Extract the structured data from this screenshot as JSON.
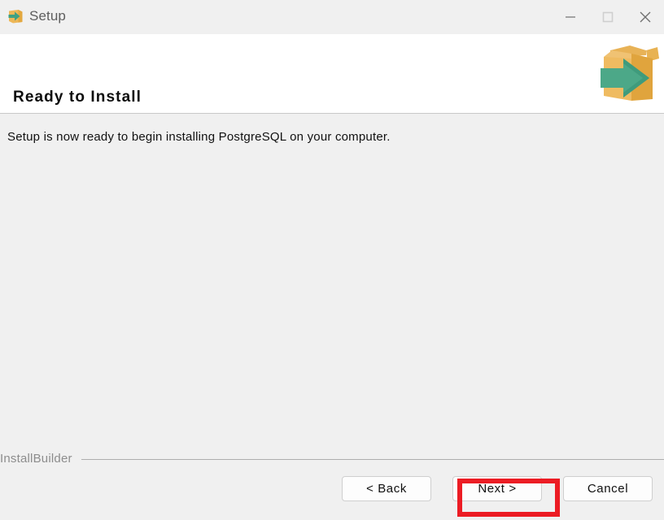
{
  "window": {
    "title": "Setup",
    "icon": "installer-box-arrow-icon"
  },
  "titlebar": {
    "minimize_label": "Minimize",
    "maximize_label": "Maximize",
    "close_label": "Close"
  },
  "header": {
    "title": "Ready to Install",
    "banner_icon": "open-box-with-green-arrow-icon"
  },
  "main": {
    "message": "Setup is now ready to begin installing PostgreSQL on your computer."
  },
  "footer": {
    "brand": "InstallBuilder",
    "buttons": {
      "back": "< Back",
      "next": "Next >",
      "cancel": "Cancel"
    }
  },
  "annotation": {
    "target": "next-button",
    "color": "#ec1c24"
  },
  "colors": {
    "titlebar_bg": "#f0f0f0",
    "header_bg": "#ffffff",
    "body_bg": "#f0f0f0",
    "box_light": "#edb757",
    "box_dark": "#e3a83f",
    "arrow_green": "#4ca888",
    "text": "#111111",
    "muted_text": "#8d8d8d"
  }
}
